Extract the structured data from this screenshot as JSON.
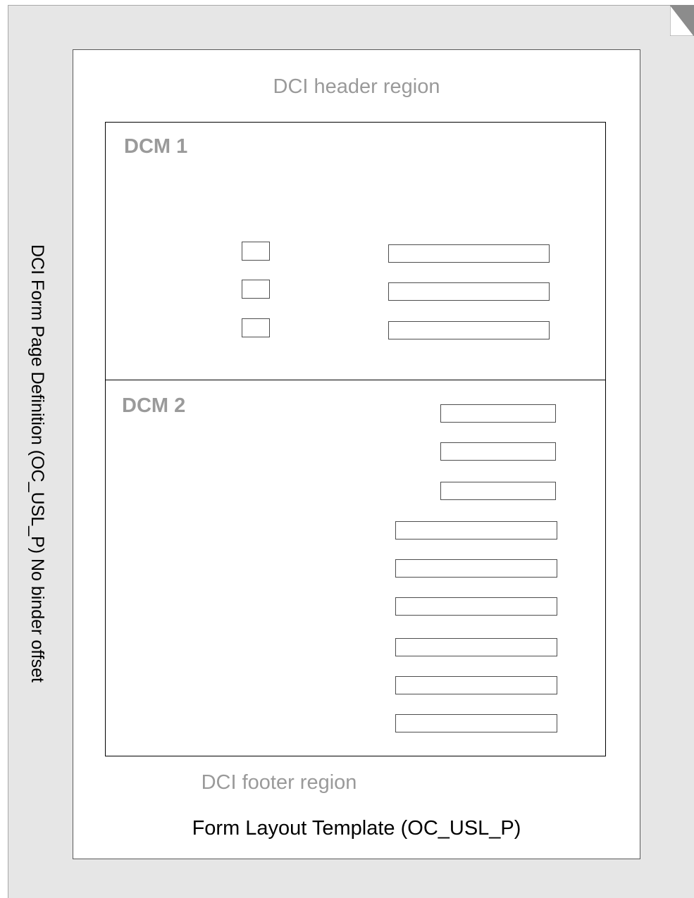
{
  "side_label": "DCI Form Page Definition (OC_USL_P) No binder offset",
  "template": {
    "header_region": "DCI header region",
    "footer_region": "DCI footer region",
    "title": "Form Layout Template (OC_USL_P)"
  },
  "dcm1": {
    "label": "DCM 1",
    "checkbox_count": 3,
    "field_count": 3
  },
  "dcm2": {
    "label": "DCM 2",
    "field_count": 9
  },
  "icons": {
    "page_fold": "page-fold-icon"
  }
}
